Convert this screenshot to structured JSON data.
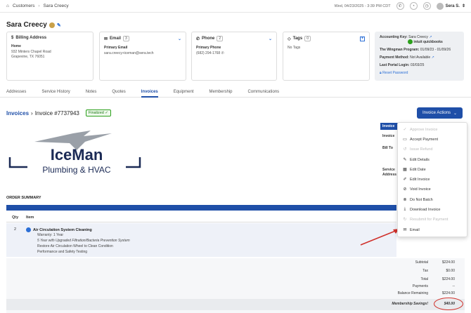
{
  "breadcrumb": {
    "root": "Customers",
    "current": "Sara Creecy"
  },
  "header": {
    "datetime": "Wed, 04/23/2025 - 3:39 PM CDT",
    "user": "Sera S."
  },
  "customer": {
    "name": "Sara Creecy"
  },
  "billing": {
    "title": "Billing Address",
    "label": "Home",
    "line1": "932 Minters Chapel Road",
    "line2": "Grapevine, TX 76051"
  },
  "email": {
    "title": "Email",
    "count": "3",
    "label": "Primary Email",
    "value": "sara.creecy+iceman@sera.tech"
  },
  "phone": {
    "title": "Phone",
    "count": "2",
    "label": "Primary Phone",
    "value": "(682) 294-1768"
  },
  "tags": {
    "title": "Tags",
    "count": "0",
    "value": "No Tags"
  },
  "account": {
    "key_label": "Accounting Key:",
    "key_value": "Sara Creecy",
    "qb_line1": "intuit",
    "qb_line2": "quickbooks",
    "membership_label": "The Wingman Program:",
    "membership_value": "01/09/23 - 01/09/26",
    "payment_label": "Payment Method:",
    "payment_value": "Not Available",
    "portal_label": "Last Portal Login:",
    "portal_value": "03/03/25",
    "reset": "Reset Password"
  },
  "tabs": [
    "Addresses",
    "Service History",
    "Notes",
    "Quotes",
    "Invoices",
    "Equipment",
    "Membership",
    "Communications"
  ],
  "invoice": {
    "crumb": "Invoices",
    "number": "Invoice #7737943",
    "status": "Finalized",
    "actions_label": "Invoice Actions"
  },
  "logo": {
    "line1": "IceMan",
    "line2": "Plumbing & HVAC"
  },
  "right_panel": {
    "header": "Invoice",
    "invoice_lbl": "Invoice",
    "bill_to": "Bill To",
    "service": "Service",
    "address": "Address"
  },
  "order": {
    "title": "ORDER SUMMARY",
    "col_qty": "Qty",
    "col_item": "Item",
    "qty": "2",
    "item_name": "Air Circulation System Cleaning",
    "warranty": "Warranty: 1 Year",
    "warranty_detail": "5 Year with Upgraded Filtration/Bacteria Prevention System",
    "desc1": "Restore Air Circulation Wheel to Clean Condition",
    "desc2": "Performance and Safety Testing"
  },
  "totals": {
    "subtotal_k": "Subtotal",
    "subtotal_v": "$224.00",
    "tax_k": "Tax",
    "tax_v": "$0.00",
    "total_k": "Total",
    "total_v": "$224.00",
    "payments_k": "Payments",
    "payments_v": "--",
    "balance_k": "Balance Remaining",
    "balance_v": "$224.00",
    "savings_k": "Membership Savings!",
    "savings_v": "$40.00"
  },
  "menu": [
    {
      "label": "Approve Invoice",
      "disabled": true,
      "icon": "check-icon"
    },
    {
      "label": "Accept Payment",
      "disabled": false,
      "icon": "card-icon"
    },
    {
      "label": "Issue Refund",
      "disabled": true,
      "icon": "refund-icon"
    },
    {
      "label": "Edit Details",
      "disabled": false,
      "icon": "edit-icon"
    },
    {
      "label": "Edit Date",
      "disabled": false,
      "icon": "calendar-icon"
    },
    {
      "label": "Edit Invoice",
      "disabled": false,
      "icon": "pencil-icon"
    },
    {
      "label": "Void Invoice",
      "disabled": false,
      "icon": "void-icon"
    },
    {
      "label": "Do Not Batch",
      "disabled": false,
      "icon": "no-batch-icon"
    },
    {
      "label": "Download Invoice",
      "disabled": false,
      "icon": "download-icon"
    },
    {
      "label": "Resubmit for Payment",
      "disabled": true,
      "icon": "resubmit-icon"
    },
    {
      "label": "Email",
      "disabled": false,
      "icon": "mail-icon"
    }
  ],
  "colors": {
    "primary": "#1f4fa8",
    "finalized": "#2ca01c",
    "annotation": "#d0302a"
  }
}
